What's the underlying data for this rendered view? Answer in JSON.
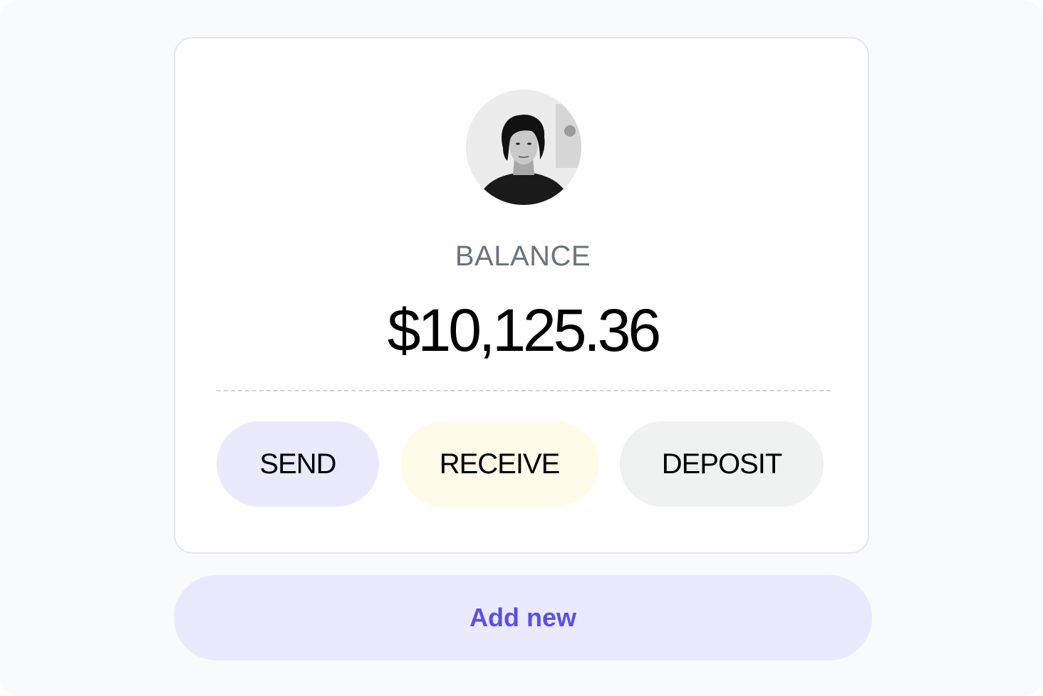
{
  "balance": {
    "label": "BALANCE",
    "amount": "$10,125.36"
  },
  "actions": {
    "send_label": "SEND",
    "receive_label": "RECEIVE",
    "deposit_label": "DEPOSIT"
  },
  "add_new": {
    "label": "Add new"
  },
  "colors": {
    "accent": "#5b4fe6",
    "send_bg": "#ebeafd",
    "receive_bg": "#fefbe9",
    "deposit_bg": "#f0f2f1",
    "add_new_bg": "#ebe9fd"
  }
}
